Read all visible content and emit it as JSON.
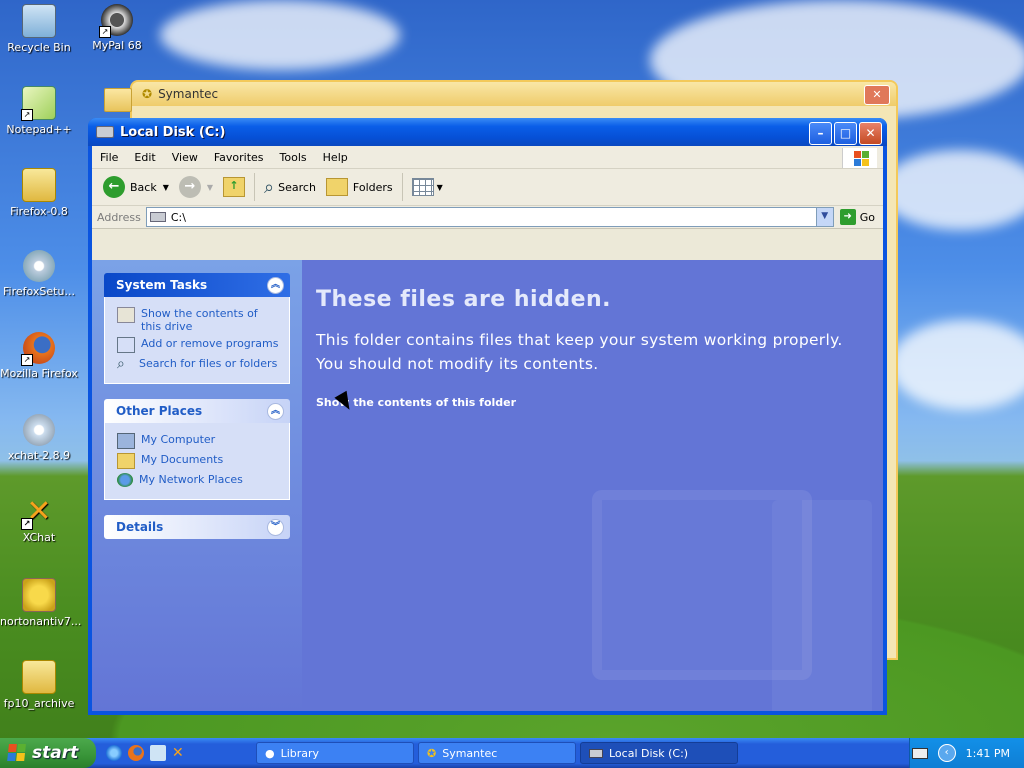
{
  "desktop": {
    "icons": [
      {
        "label": "Recycle Bin"
      },
      {
        "label": "MyPal 68"
      },
      {
        "label": "Notepad++"
      },
      {
        "label": "Firefox-0.8"
      },
      {
        "label": "FirefoxSetu..."
      },
      {
        "label": "Mozilla Firefox"
      },
      {
        "label": "xchat-2.8.9"
      },
      {
        "label": "XChat"
      },
      {
        "label": "nortonantiv7..."
      },
      {
        "label": "fp10_archive"
      }
    ]
  },
  "background_window": {
    "title": "Symantec"
  },
  "window": {
    "title": "Local Disk (C:)",
    "menu": [
      "File",
      "Edit",
      "View",
      "Favorites",
      "Tools",
      "Help"
    ],
    "toolbar": {
      "back": "Back",
      "search": "Search",
      "folders": "Folders"
    },
    "address": {
      "label": "Address",
      "value": "C:\\",
      "go": "Go"
    },
    "system_tasks": {
      "title": "System Tasks",
      "items": [
        "Show the contents of this drive",
        "Add or remove programs",
        "Search for files or folders"
      ]
    },
    "other_places": {
      "title": "Other Places",
      "items": [
        "My Computer",
        "My Documents",
        "My Network Places"
      ]
    },
    "details": {
      "title": "Details"
    },
    "content": {
      "heading": "These files are hidden.",
      "line1": "This folder contains files that keep your system working properly.",
      "line2": "You should not modify its contents.",
      "link": "Show the contents of this folder"
    }
  },
  "taskbar": {
    "start": "start",
    "tasks": [
      "Library",
      "Symantec",
      "Local Disk (C:)"
    ],
    "clock": "1:41 PM"
  }
}
